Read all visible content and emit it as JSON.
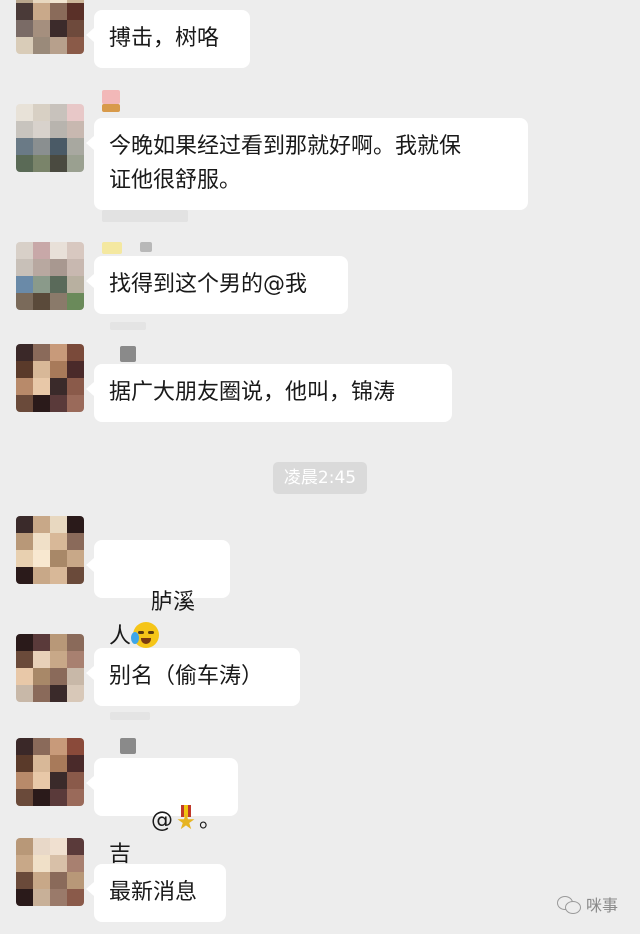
{
  "messages": [
    {
      "text": "搏击，树咯"
    },
    {
      "text": "今晚如果经过看到那就好啊。我就保\n证他很舒服。"
    },
    {
      "text": "找得到这个男的@我"
    },
    {
      "text": "据广大朋友圈说，他叫，锦涛"
    },
    {
      "text": "胪溪人"
    },
    {
      "text": "别名（偷车涛）"
    },
    {
      "text_before": "@",
      "text_after": "。吉"
    },
    {
      "text": "最新消息"
    }
  ],
  "timestamp": "凌晨2:45",
  "watermark": {
    "label": "咪事",
    "icon": "wechat-official-account-icon"
  },
  "emojis": {
    "crying": "crying-face-emoji",
    "medal": "military-medal-emoji"
  },
  "colors": {
    "background": "#ededed",
    "bubble": "#ffffff",
    "text": "#191919",
    "timestamp_bg": "#dadada"
  }
}
